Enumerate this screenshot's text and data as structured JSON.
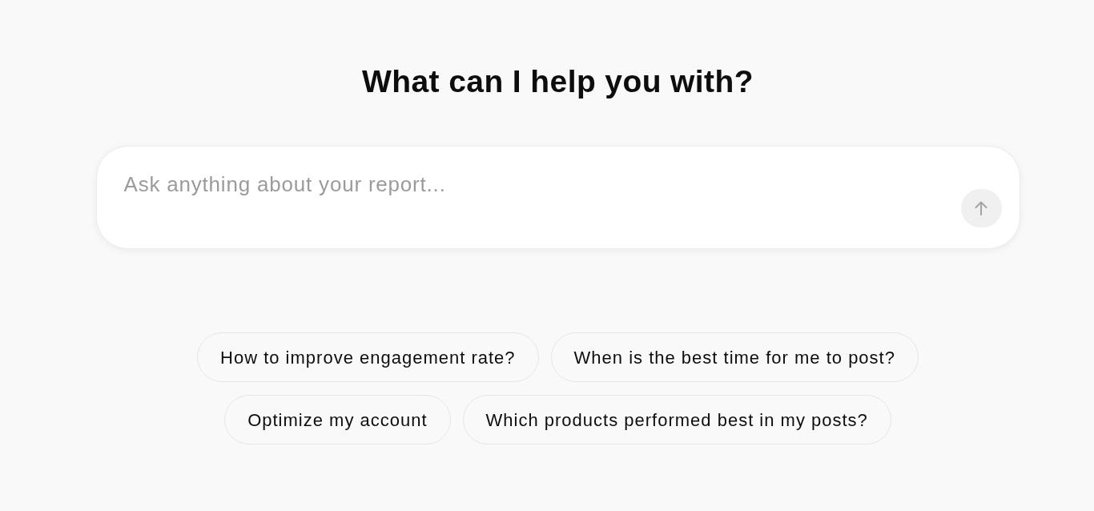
{
  "heading": "What can I help you with?",
  "prompt_box": {
    "placeholder": "Ask anything about your report...",
    "send_button": {
      "disabled": true
    }
  },
  "suggestions": [
    "How to improve engagement rate?",
    "When is the best time for me to post?",
    "Optimize my account",
    "Which products performed best in my posts?"
  ]
}
